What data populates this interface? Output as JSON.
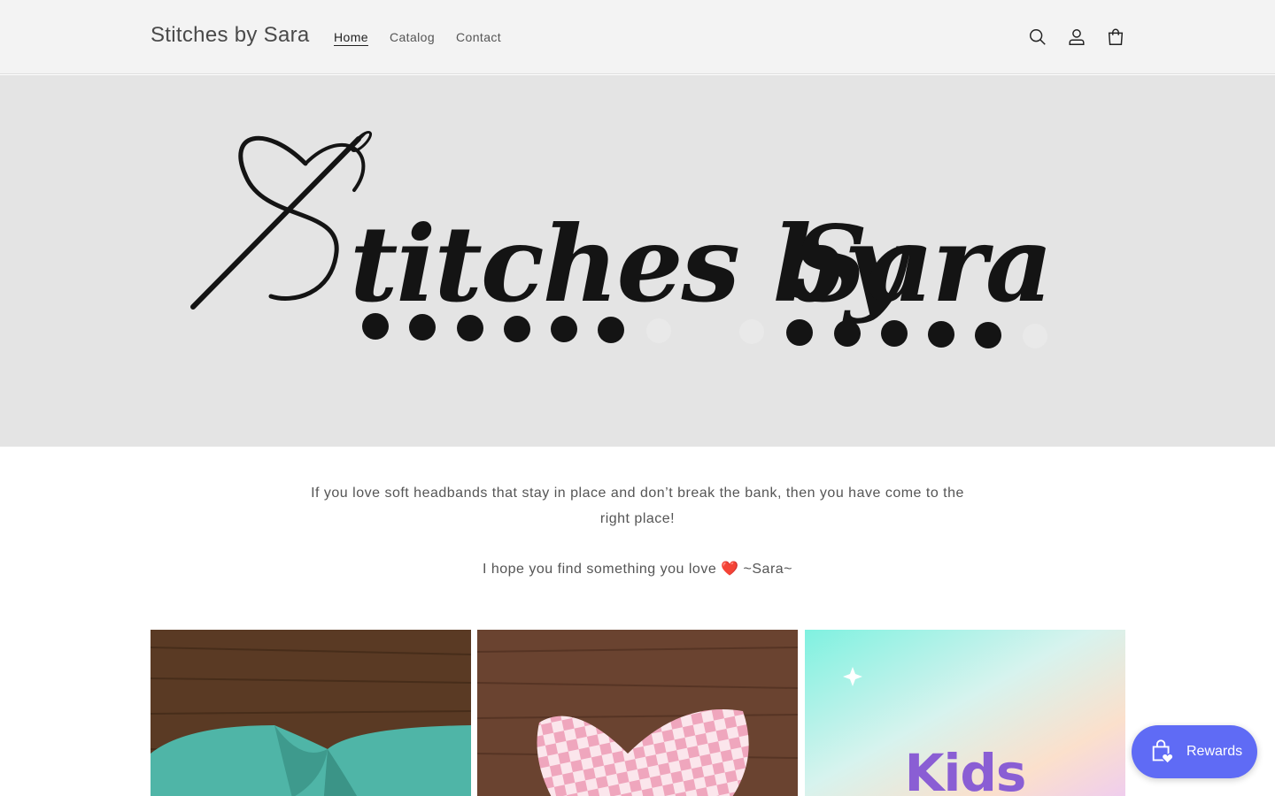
{
  "header": {
    "brand": "Stitches by Sara",
    "nav": [
      {
        "label": "Home",
        "active": true
      },
      {
        "label": "Catalog",
        "active": false
      },
      {
        "label": "Contact",
        "active": false
      }
    ],
    "icons": [
      "search-icon",
      "account-icon",
      "cart-icon"
    ]
  },
  "hero": {
    "logo_text": "Stitches by Sara"
  },
  "intro": {
    "line1": "If you love soft headbands that stay in place and don’t break the bank, then you have come to the right place!",
    "line2_before": "I hope you find something you love ",
    "heart": "❤️",
    "line2_after": " ~Sara~"
  },
  "collections": [
    {
      "image": "teal twist headband on wood"
    },
    {
      "image": "pink checkered bow headband on wood"
    },
    {
      "label": "Kids"
    }
  ],
  "rewards": {
    "label": "Rewards",
    "color": "#5f6bf5"
  }
}
